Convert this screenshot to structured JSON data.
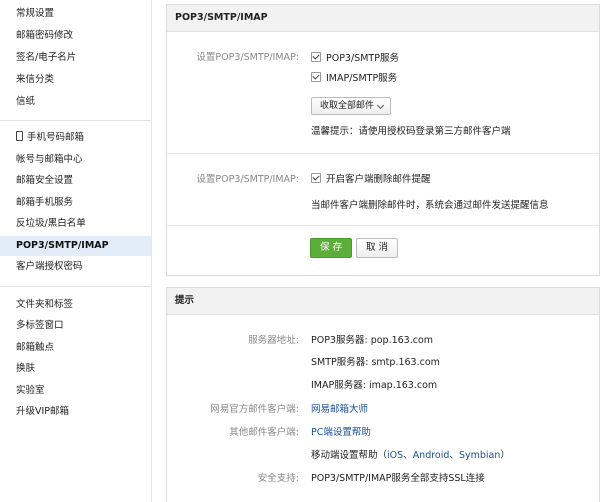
{
  "sidebar": {
    "group1": [
      "常规设置",
      "邮箱密码修改",
      "签名/电子名片",
      "来信分类",
      "信纸"
    ],
    "group2": [
      "手机号码邮箱",
      "帐号与邮箱中心",
      "邮箱安全设置",
      "邮箱手机服务",
      "反垃圾/黑白名单",
      "POP3/SMTP/IMAP",
      "客户端授权密码"
    ],
    "group3": [
      "文件夹和标签",
      "多标签窗口",
      "邮箱触点",
      "换肤",
      "实验室",
      "升级VIP邮箱"
    ],
    "active": "POP3/SMTP/IMAP"
  },
  "pop_panel": {
    "title": "POP3/SMTP/IMAP",
    "label1": "设置POP3/SMTP/IMAP:",
    "opt_pop3": "POP3/SMTP服务",
    "opt_imap": "IMAP/SMTP服务",
    "dropdown_value": "收取全部邮件",
    "tip": "温馨提示：请使用授权码登录第三方邮件客户端",
    "label2": "设置POP3/SMTP/IMAP:",
    "opt_delete_notify": "开启客户端删除邮件提醒",
    "delete_note": "当邮件客户端删除邮件时，系统会通过邮件发送提醒信息",
    "save": "保 存",
    "cancel": "取 消"
  },
  "tips_panel": {
    "title": "提示",
    "server_label": "服务器地址:",
    "pop3": "POP3服务器: pop.163.com",
    "smtp": "SMTP服务器: smtp.163.com",
    "imap": "IMAP服务器: imap.163.com",
    "official_label": "网易官方邮件客户端:",
    "official_link": "网易邮箱大师",
    "other_label": "其他邮件客户端:",
    "pc_link": "PC端设置帮助",
    "mobile_prefix": "移动端设置帮助（",
    "ios": "iOS",
    "sep1": "、",
    "android": "Android",
    "sep2": "、",
    "symbian": "Symbian",
    "mobile_suffix": "）",
    "security_label": "安全支持:",
    "security_text": "POP3/SMTP/IMAP服务全部支持SSL连接"
  }
}
